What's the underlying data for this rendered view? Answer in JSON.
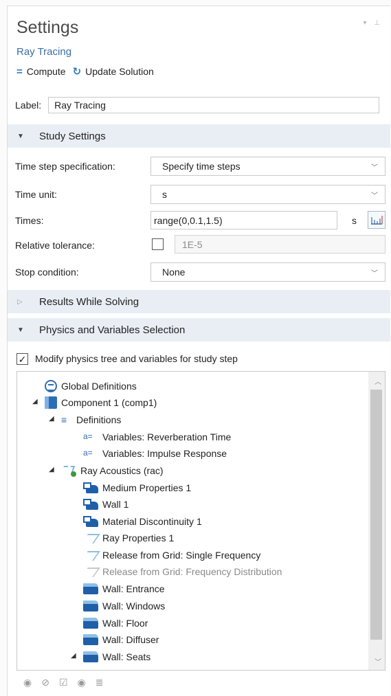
{
  "header": {
    "title": "Settings",
    "subtitle": "Ray Tracing"
  },
  "toolbar": {
    "compute_label": "Compute",
    "update_label": "Update Solution"
  },
  "label_field": {
    "label": "Label:",
    "value": "Ray Tracing"
  },
  "sections": {
    "study_settings": "Study Settings",
    "results_while_solving": "Results While Solving",
    "physics_selection": "Physics and Variables Selection"
  },
  "study_settings": {
    "time_step_label": "Time step specification:",
    "time_step_value": "Specify time steps",
    "time_unit_label": "Time unit:",
    "time_unit_value": "s",
    "times_label": "Times:",
    "times_value": "range(0,0.1,1.5)",
    "times_unit": "s",
    "rel_tol_label": "Relative tolerance:",
    "rel_tol_value": "1E-5",
    "stop_label": "Stop condition:",
    "stop_value": "None"
  },
  "physics": {
    "modify_label": "Modify physics tree and variables for study step",
    "tree": [
      {
        "label": "Global Definitions"
      },
      {
        "label": "Component 1 (comp1)"
      },
      {
        "label": "Definitions"
      },
      {
        "label": "Variables: Reverberation Time"
      },
      {
        "label": "Variables: Impulse Response"
      },
      {
        "label": "Ray Acoustics (rac)"
      },
      {
        "label": "Medium Properties 1"
      },
      {
        "label": "Wall 1"
      },
      {
        "label": "Material Discontinuity 1"
      },
      {
        "label": "Ray Properties 1"
      },
      {
        "label": "Release from Grid: Single Frequency"
      },
      {
        "label": "Release from Grid: Frequency Distribution"
      },
      {
        "label": "Wall: Entrance"
      },
      {
        "label": "Wall: Windows"
      },
      {
        "label": "Wall: Floor"
      },
      {
        "label": "Wall: Diffuser"
      },
      {
        "label": "Wall: Seats"
      }
    ]
  }
}
